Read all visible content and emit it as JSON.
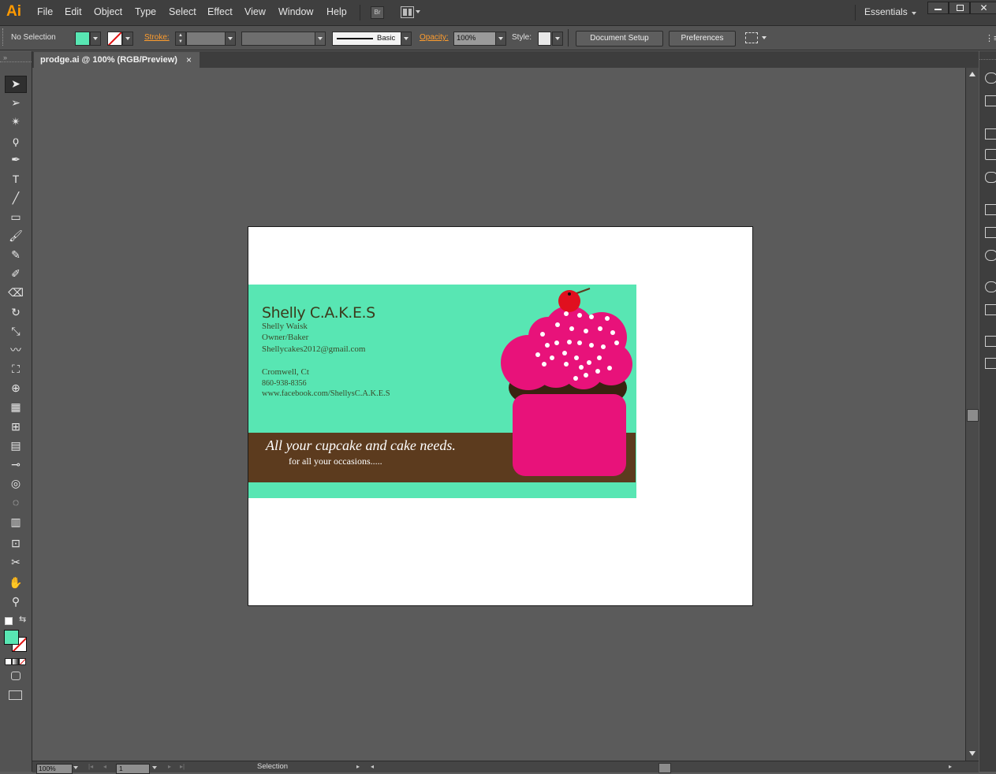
{
  "app": {
    "logo": "Ai"
  },
  "menu": {
    "items": [
      "File",
      "Edit",
      "Object",
      "Type",
      "Select",
      "Effect",
      "View",
      "Window",
      "Help"
    ],
    "bridge": "Br",
    "workspace": "Essentials"
  },
  "control_bar": {
    "selection_status": "No Selection",
    "stroke_label": "Stroke:",
    "brush_label": "Basic",
    "opacity_label": "Opacity:",
    "opacity_value": "100%",
    "style_label": "Style:",
    "document_setup": "Document Setup",
    "preferences": "Preferences",
    "fill_color": "#58e6b3"
  },
  "document": {
    "tab_title": "prodge.ai @ 100% (RGB/Preview)",
    "close": "×"
  },
  "tools": [
    "selection-tool",
    "direct-selection-tool",
    "magic-wand-tool",
    "lasso-tool",
    "pen-tool",
    "type-tool",
    "line-tool",
    "rectangle-tool",
    "paintbrush-tool",
    "pencil-tool",
    "blob-brush-tool",
    "eraser-tool",
    "rotate-tool",
    "scale-tool",
    "warp-tool",
    "free-transform-tool",
    "shape-builder-tool",
    "perspective-grid-tool",
    "mesh-tool",
    "gradient-tool",
    "eyedropper-tool",
    "blend-tool",
    "symbol-sprayer-tool",
    "column-graph-tool",
    "artboard-tool",
    "slice-tool",
    "hand-tool",
    "zoom-tool"
  ],
  "card": {
    "title": "Shelly C.A.K.E.S",
    "name": "Shelly Waisk",
    "role": "Owner/Baker",
    "email": "Shellycakes2012@gmail.com",
    "city": "Cromwell, Ct",
    "phone": "860-938-8356",
    "web": "www.facebook.com/ShellysC.A.K.E.S",
    "tagline": "All your cupcake and cake needs.",
    "subtagline": "for all your occasions.....",
    "colors": {
      "background": "#58e6b3",
      "band": "#5c3b1e",
      "frosting": "#e8127a",
      "cupcake_base": "#e8127a",
      "cherry": "#e0101f",
      "cake": "#3a2210"
    }
  },
  "status_bar": {
    "zoom": "100%",
    "page": "1",
    "tool": "Selection"
  }
}
